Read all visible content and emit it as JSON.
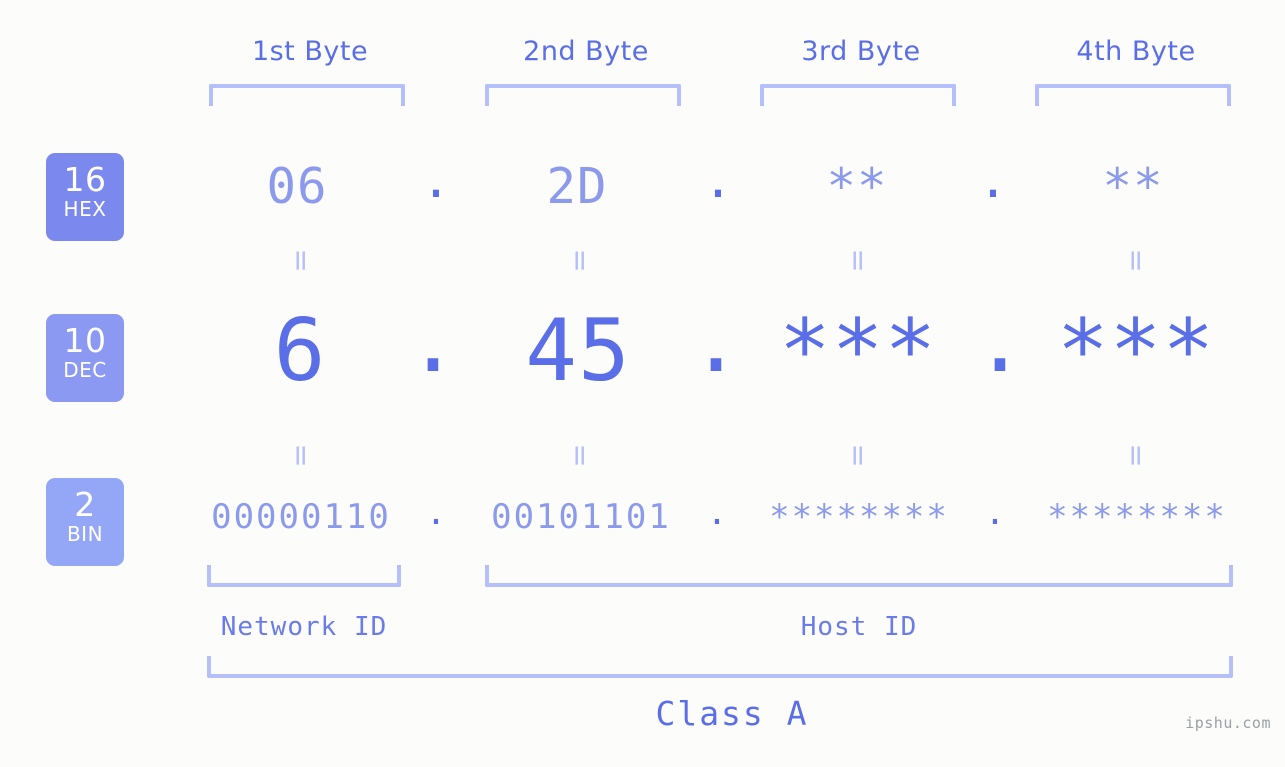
{
  "page": {
    "background_color": "#fcfdfa",
    "accent_color": "#5a6ee8",
    "accent_light_color": "#8b9aed",
    "bracket_color": "#b5c0fb",
    "watermark": "ipshu.com"
  },
  "byte_headers": [
    {
      "label": "1st Byte"
    },
    {
      "label": "2nd Byte"
    },
    {
      "label": "3rd Byte"
    },
    {
      "label": "4th Byte"
    }
  ],
  "bases": [
    {
      "number": "16",
      "name": "HEX",
      "color": "#7b89ee"
    },
    {
      "number": "10",
      "name": "DEC",
      "color": "#8b99f3"
    },
    {
      "number": "2",
      "name": "BIN",
      "color": "#94a7f6"
    }
  ],
  "rows": {
    "hex": {
      "values": [
        "06",
        "2D",
        "**",
        "**"
      ],
      "separators": [
        ".",
        ".",
        "."
      ]
    },
    "dec": {
      "values": [
        "6",
        "45",
        "***",
        "***"
      ],
      "separators": [
        ".",
        ".",
        "."
      ]
    },
    "bin": {
      "values": [
        "00000110",
        "00101101",
        "********",
        "********"
      ],
      "separators": [
        ".",
        ".",
        "."
      ]
    }
  },
  "equals_symbols": {
    "symbol": "="
  },
  "id_labels": [
    {
      "label": "Network ID"
    },
    {
      "label": "Host ID"
    }
  ],
  "class_label": "Class A"
}
